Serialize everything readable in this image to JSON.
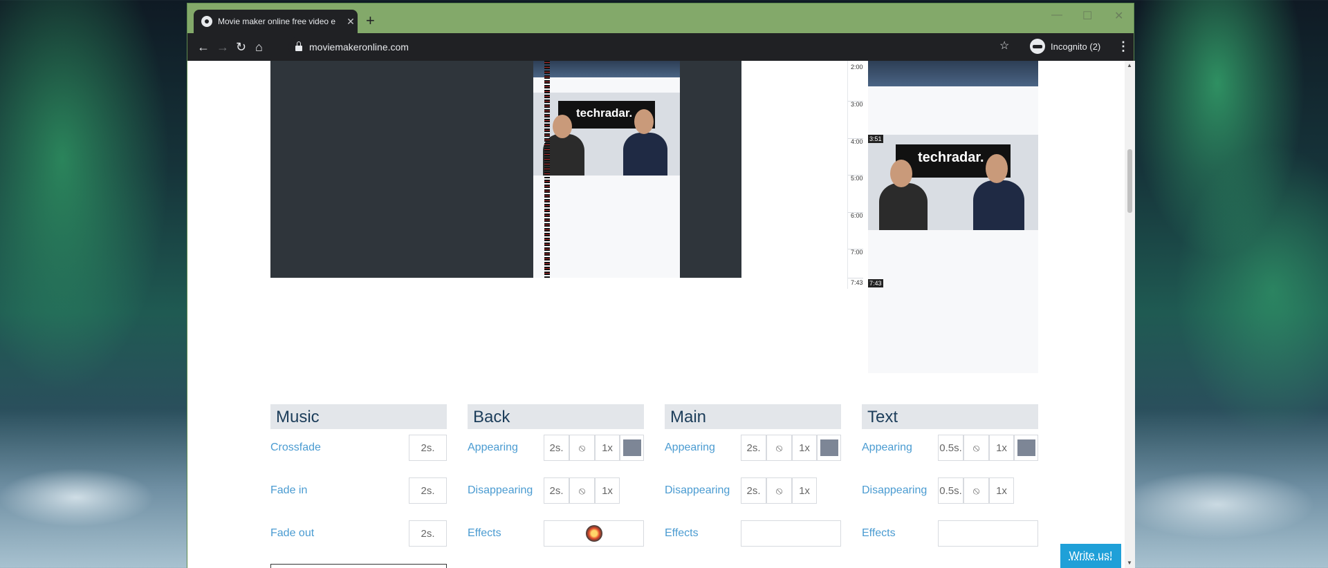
{
  "browser": {
    "tab_title": "Movie maker online free video e",
    "tab_close": "✕",
    "new_tab": "+",
    "window_controls": {
      "minimize": "—",
      "maximize": "☐",
      "close": "✕"
    },
    "back": "←",
    "forward": "→",
    "reload": "↻",
    "home": "⌂",
    "url": "moviemakeronline.com",
    "bookmark_star": "☆",
    "profile_label": "Incognito (2)",
    "menu": "⋮"
  },
  "preview": {
    "logo_text": "techradar."
  },
  "timeline": {
    "ticks": [
      "2:00",
      "3:00",
      "4:00",
      "5:00",
      "6:00",
      "7:00",
      "7:43"
    ],
    "clip_start_badge": "3:51",
    "clip_end_badge": "7:43",
    "logo_text": "techradar."
  },
  "sections": {
    "music": {
      "title": "Music",
      "crossfade": {
        "label": "Crossfade",
        "value": "2s."
      },
      "fade_in": {
        "label": "Fade in",
        "value": "2s."
      },
      "fade_out": {
        "label": "Fade out",
        "value": "2s."
      }
    },
    "back": {
      "title": "Back",
      "appearing": {
        "label": "Appearing",
        "duration": "2s.",
        "speed": "1x"
      },
      "disappearing": {
        "label": "Disappearing",
        "duration": "2s.",
        "speed": "1x"
      },
      "effects": {
        "label": "Effects"
      }
    },
    "main": {
      "title": "Main",
      "appearing": {
        "label": "Appearing",
        "duration": "2s.",
        "speed": "1x"
      },
      "disappearing": {
        "label": "Disappearing",
        "duration": "2s.",
        "speed": "1x"
      },
      "effects": {
        "label": "Effects"
      }
    },
    "text": {
      "title": "Text",
      "appearing": {
        "label": "Appearing",
        "duration": "0.5s.",
        "speed": "1x"
      },
      "disappearing": {
        "label": "Disappearing",
        "duration": "0.5s.",
        "speed": "1x"
      },
      "effects": {
        "label": "Effects"
      }
    }
  },
  "icons": {
    "none": "⦸",
    "scroll_up": "▲",
    "scroll_down": "▼"
  },
  "colors": {
    "swatch": "#7d8696",
    "accent": "#4a9bd1",
    "write_us_bg": "#1fa0d8"
  },
  "write_us": "Write us!"
}
